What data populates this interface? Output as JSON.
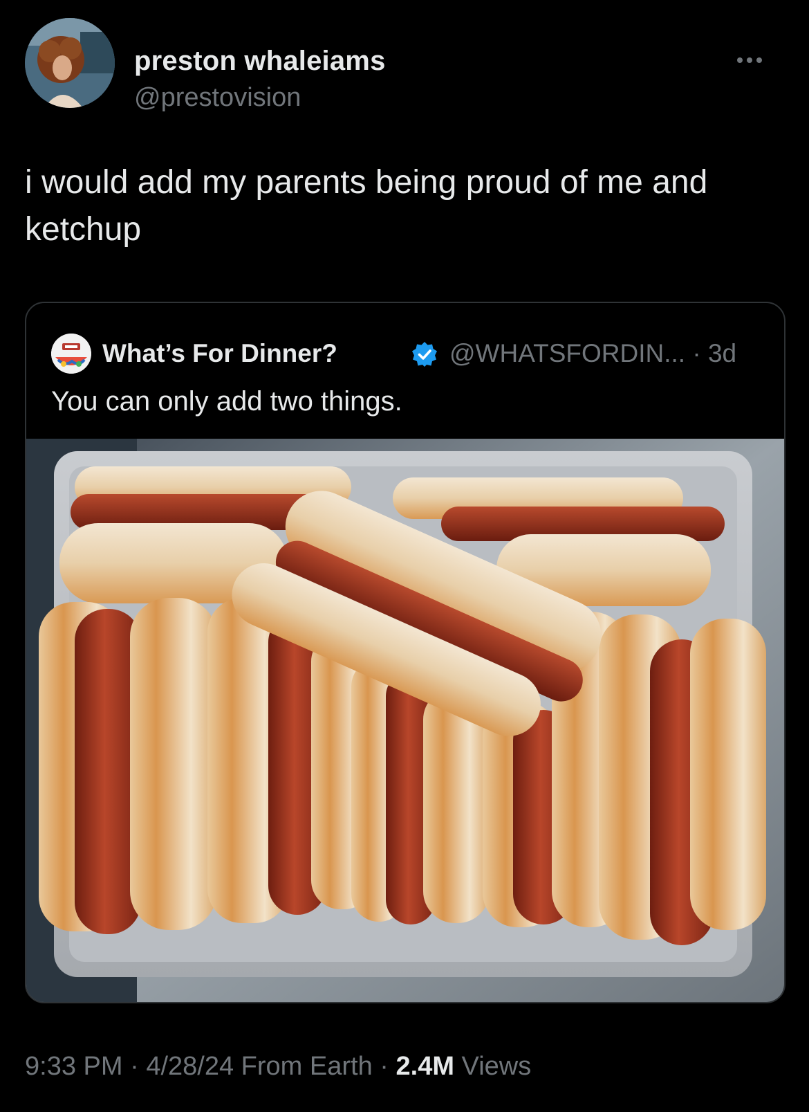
{
  "tweet": {
    "author": {
      "display_name": "preston whaleiams",
      "handle": "@prestovision",
      "avatar_icon": "profile-photo"
    },
    "more_icon": "more-options-icon",
    "text": "i would add my parents being proud of me and\nketchup",
    "quoted_tweet": {
      "author": {
        "display_name": "What’s For Dinner?",
        "verified": true,
        "verified_color": "#1d9bf0",
        "handle_and_time": "@WHATSFORDIN... · 3d"
      },
      "text": "You can only add two things.",
      "image": "photo of hot dogs in toasted buns on a metal sheet pan"
    },
    "meta": {
      "time": "9:33 PM",
      "sep1": " · ",
      "date": "4/28/24",
      "source": " From Earth",
      "sep2": " · ",
      "views_count": "2.4M",
      "views_label": " Views"
    }
  },
  "colors": {
    "background": "#000000",
    "primary_text": "#e7e9ea",
    "secondary_text": "#71767b",
    "border": "#2f3336"
  }
}
